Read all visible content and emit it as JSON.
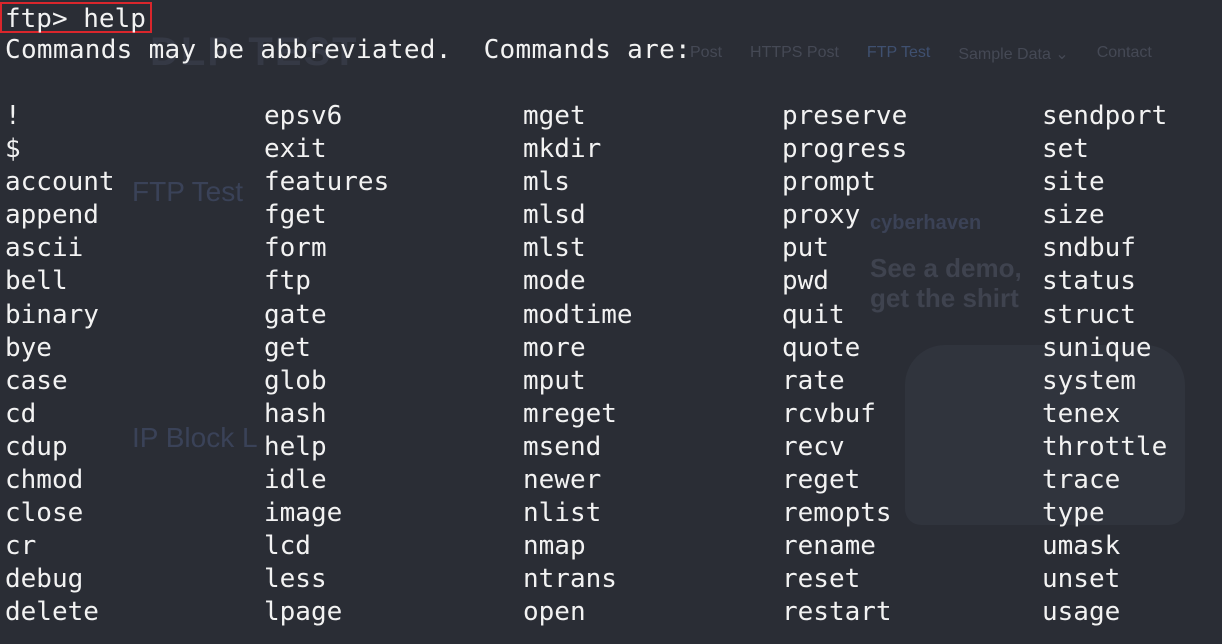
{
  "terminal": {
    "prompt": "ftp> help",
    "intro": "Commands may be abbreviated.  Commands are:",
    "columns": [
      [
        "!",
        "$",
        "account",
        "append",
        "ascii",
        "bell",
        "binary",
        "bye",
        "case",
        "cd",
        "cdup",
        "chmod",
        "close",
        "cr",
        "debug",
        "delete"
      ],
      [
        "epsv6",
        "exit",
        "features",
        "fget",
        "form",
        "ftp",
        "gate",
        "get",
        "glob",
        "hash",
        "help",
        "idle",
        "image",
        "lcd",
        "less",
        "lpage"
      ],
      [
        "mget",
        "mkdir",
        "mls",
        "mlsd",
        "mlst",
        "mode",
        "modtime",
        "more",
        "mput",
        "mreget",
        "msend",
        "newer",
        "nlist",
        "nmap",
        "ntrans",
        "open"
      ],
      [
        "preserve",
        "progress",
        "prompt",
        "proxy",
        "put",
        "pwd",
        "quit",
        "quote",
        "rate",
        "rcvbuf",
        "recv",
        "reget",
        "remopts",
        "rename",
        "reset",
        "restart"
      ],
      [
        "sendport",
        "set",
        "site",
        "size",
        "sndbuf",
        "status",
        "struct",
        "sunique",
        "system",
        "tenex",
        "throttle",
        "trace",
        "type",
        "umask",
        "unset",
        "usage"
      ]
    ]
  },
  "background_page": {
    "nav": [
      "Post",
      "HTTPS Post",
      "FTP Test",
      "Sample Data ⌄",
      "Contact"
    ],
    "ftp_heading": "FTP Test",
    "ip_heading": "IP Block L",
    "ad_brand": "cyberhaven",
    "ad_text": "See a demo, get the shirt"
  },
  "colors": {
    "terminal_bg": "#2a2d35",
    "terminal_text": "#f2f2f2",
    "highlight_box": "#d9262c"
  }
}
